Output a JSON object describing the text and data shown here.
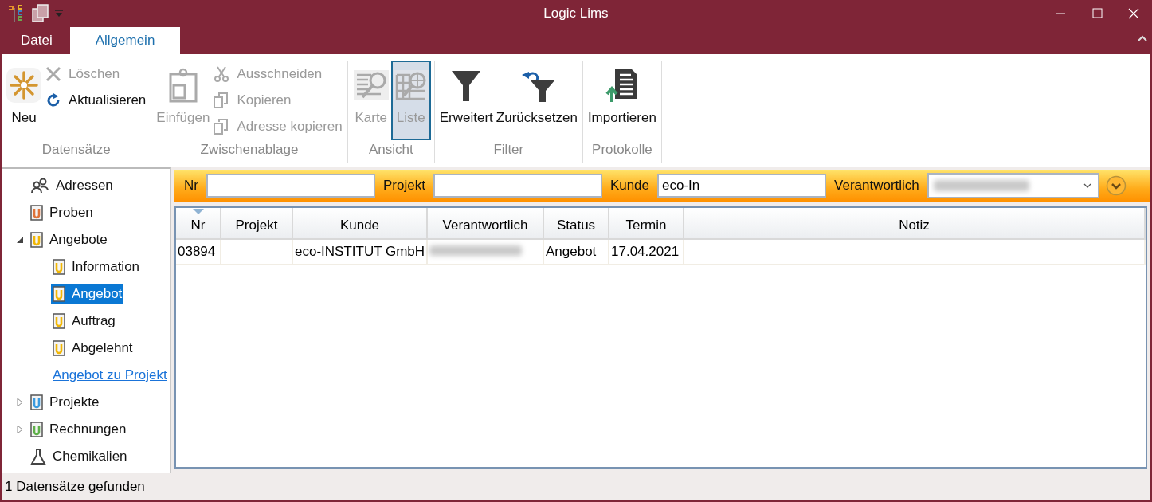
{
  "window": {
    "title": "Logic Lims"
  },
  "ribbon_tabs": [
    {
      "label": "Datei",
      "selected": false
    },
    {
      "label": "Allgemein",
      "selected": true
    }
  ],
  "ribbon_groups": [
    {
      "label": "Datensätze",
      "items": [
        {
          "label": "Neu",
          "kind": "large",
          "disabled": false
        },
        {
          "label": "Löschen",
          "kind": "small",
          "disabled": true
        },
        {
          "label": "Aktualisieren",
          "kind": "small",
          "disabled": false
        }
      ]
    },
    {
      "label": "Zwischenablage",
      "items": [
        {
          "label": "Einfügen",
          "kind": "large",
          "disabled": true
        },
        {
          "label": "Ausschneiden",
          "kind": "small",
          "disabled": true
        },
        {
          "label": "Kopieren",
          "kind": "small",
          "disabled": true
        },
        {
          "label": "Adresse kopieren",
          "kind": "small",
          "disabled": true
        }
      ]
    },
    {
      "label": "Ansicht",
      "items": [
        {
          "label": "Karte",
          "kind": "large",
          "disabled": true,
          "selected": false
        },
        {
          "label": "Liste",
          "kind": "large",
          "disabled": true,
          "selected": true
        }
      ]
    },
    {
      "label": "Filter",
      "items": [
        {
          "label": "Erweitert",
          "kind": "large",
          "disabled": false
        },
        {
          "label": "Zurücksetzen",
          "kind": "large",
          "disabled": false
        }
      ]
    },
    {
      "label": "Protokolle",
      "items": [
        {
          "label": "Importieren",
          "kind": "large",
          "disabled": false
        }
      ]
    }
  ],
  "tree": [
    {
      "label": "Adressen",
      "kind": "node",
      "selected": false
    },
    {
      "label": "Proben",
      "kind": "node",
      "selected": false,
      "color": "#e0733a"
    },
    {
      "label": "Angebote",
      "kind": "node",
      "selected": false,
      "color": "#f2b705",
      "expanded": true,
      "children": [
        {
          "label": "Information",
          "kind": "node",
          "selected": false,
          "color": "#f2b705"
        },
        {
          "label": "Angebot",
          "kind": "node",
          "selected": true,
          "color": "#f2b705"
        },
        {
          "label": "Auftrag",
          "kind": "node",
          "selected": false,
          "color": "#f2b705"
        },
        {
          "label": "Abgelehnt",
          "kind": "node",
          "selected": false,
          "color": "#f2b705"
        },
        {
          "label": "Angebot zu Projekt",
          "kind": "link",
          "selected": false
        }
      ]
    },
    {
      "label": "Projekte",
      "kind": "node",
      "selected": false,
      "color": "#3a9be0",
      "expanded": false
    },
    {
      "label": "Rechnungen",
      "kind": "node",
      "selected": false,
      "color": "#5fb04a",
      "expanded": false
    },
    {
      "label": "Chemikalien",
      "kind": "node",
      "selected": false
    }
  ],
  "filter_fields": [
    {
      "label": "Nr",
      "kind": "text"
    },
    {
      "label": "Projekt",
      "kind": "text"
    },
    {
      "label": "Kunde",
      "kind": "text",
      "value": "eco-In"
    },
    {
      "label": "Verantwortlich",
      "kind": "combo",
      "blurred": true
    }
  ],
  "table": {
    "columns": [
      {
        "label": "Nr",
        "sorted": true
      },
      {
        "label": "Projekt",
        "sorted": false
      },
      {
        "label": "Kunde",
        "sorted": false
      },
      {
        "label": "Verantwortlich",
        "sorted": false
      },
      {
        "label": "Status",
        "sorted": false
      },
      {
        "label": "Termin",
        "sorted": false
      },
      {
        "label": "Notiz",
        "sorted": false
      }
    ],
    "rows": [
      {
        "cells": [
          "03894",
          null,
          "eco-INSTITUT GmbH",
          {
            "blurred": true
          },
          "Angebot",
          "17.04.2021",
          null
        ]
      }
    ]
  },
  "status_bar": "1 Datensätze gefunden"
}
